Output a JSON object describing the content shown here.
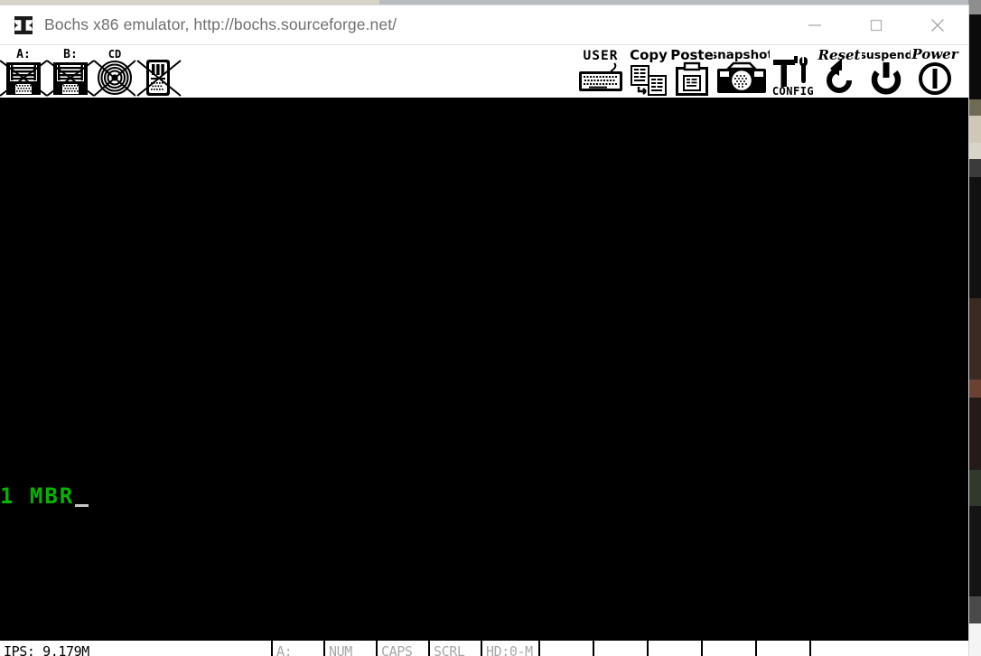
{
  "window": {
    "title": "Bochs x86 emulator, http://bochs.sourceforge.net/",
    "logo_icon": "bochs-logo-icon",
    "controls": [
      {
        "name": "minimize-button",
        "icon": "minimize-icon",
        "label": "—"
      },
      {
        "name": "maximize-button",
        "icon": "maximize-icon",
        "label": "□"
      },
      {
        "name": "close-button",
        "icon": "close-icon",
        "label": "✕"
      }
    ]
  },
  "toolbar": {
    "left_items": [
      {
        "name": "floppy-a-button",
        "label": "A:",
        "icon": "floppy-disk-icon",
        "ejected": true
      },
      {
        "name": "floppy-b-button",
        "label": "B:",
        "icon": "floppy-disk-icon",
        "ejected": true
      },
      {
        "name": "cdrom-button",
        "label": "CD",
        "icon": "cdrom-disc-icon",
        "ejected": true
      },
      {
        "name": "usb-button",
        "label": "",
        "icon": "usb-device-icon",
        "ejected": true
      }
    ],
    "right_items": [
      {
        "name": "user-button",
        "label": "USER",
        "icon": "keyboard-icon"
      },
      {
        "name": "copy-button",
        "label": "Copy",
        "icon": "copy-pages-icon"
      },
      {
        "name": "paste-button",
        "label": "Poste",
        "icon": "clipboard-icon"
      },
      {
        "name": "snapshot-button",
        "label": "snapshot",
        "icon": "camera-icon"
      },
      {
        "name": "config-button",
        "label": "CONFIG",
        "icon": "hammer-wrench-icon"
      },
      {
        "name": "reset-button",
        "label": "Reset",
        "icon": "reset-arrow-icon"
      },
      {
        "name": "suspend-button",
        "label": "suspend",
        "icon": "suspend-power-icon"
      },
      {
        "name": "power-button",
        "label": "Power",
        "icon": "power-circle-icon"
      }
    ]
  },
  "screen": {
    "background_color": "#000000",
    "text_color": "#00b400",
    "cursor_color": "#c8c8c8",
    "line": "1 MBR"
  },
  "statusbar": {
    "ips": "IPS: 9.179M",
    "cells": [
      {
        "name": "status-floppy-a",
        "label": "A:",
        "active": false
      },
      {
        "name": "status-num-lock",
        "label": "NUM",
        "active": false
      },
      {
        "name": "status-caps-lock",
        "label": "CAPS",
        "active": false
      },
      {
        "name": "status-scroll-lock",
        "label": "SCRL",
        "active": false
      },
      {
        "name": "status-hard-disk",
        "label": "HD:0-M",
        "active": false
      },
      {
        "name": "status-spare-1",
        "label": "",
        "active": false
      },
      {
        "name": "status-spare-2",
        "label": "",
        "active": false
      },
      {
        "name": "status-spare-3",
        "label": "",
        "active": false
      },
      {
        "name": "status-spare-4",
        "label": "",
        "active": false
      },
      {
        "name": "status-spare-5",
        "label": "",
        "active": false
      },
      {
        "name": "status-spare-6",
        "label": "",
        "active": false
      }
    ]
  }
}
